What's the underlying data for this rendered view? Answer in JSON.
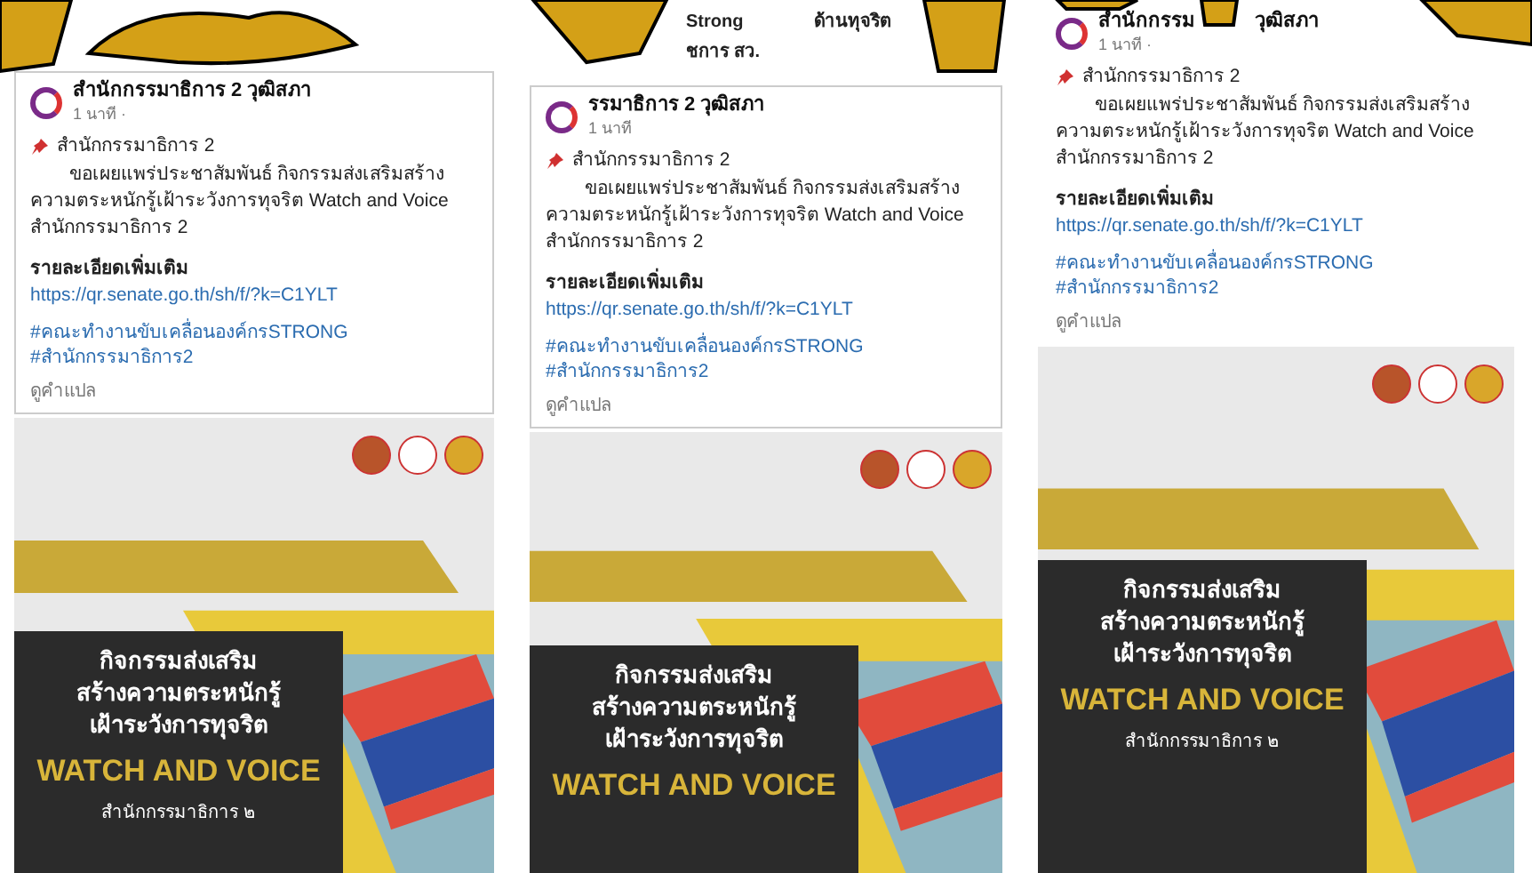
{
  "panels": [
    {
      "post": {
        "author": "สำนักกรรมาธิการ 2 วุฒิสภา",
        "time": "1 นาที ·",
        "org": "สำนักกรรมาธิการ 2",
        "body": "ขอเผยแพร่ประชาสัมพันธ์ กิจกรรมส่งเสริมสร้างความตระหนักรู้เฝ้าระวังการทุจริต Watch and Voice สำนักกรรมาธิการ 2",
        "more_label": "รายละเอียดเพิ่มเติม",
        "link": "https://qr.senate.go.th/sh/f/?k=C1YLT",
        "hashtags": [
          "#คณะทำงานขับเคลื่อนองค์กรSTRONG",
          "#สำนักกรรมาธิการ2"
        ],
        "translate": "ดูคำแปล"
      },
      "poster": {
        "title_lines": [
          "กิจกรรมส่งเสริม",
          "สร้างความตระหนักรู้",
          "เฝ้าระวังการทุจริต"
        ],
        "headline": "WATCH AND VOICE",
        "footer": "สำนักกรรมาธิการ ๒"
      }
    },
    {
      "header_fragments": [
        "Strong",
        "ด้านทุจริต",
        "ชการ สว."
      ],
      "post": {
        "author": "รรมาธิการ 2 วุฒิสภา",
        "time": "1 นาที",
        "org": "สำนักกรรมาธิการ 2",
        "body": "ขอเผยแพร่ประชาสัมพันธ์ กิจกรรมส่งเสริมสร้างความตระหนักรู้เฝ้าระวังการทุจริต Watch and Voice สำนักกรรมาธิการ 2",
        "more_label": "รายละเอียดเพิ่มเติม",
        "link": "https://qr.senate.go.th/sh/f/?k=C1YLT",
        "hashtags": [
          "#คณะทำงานขับเคลื่อนองค์กรSTRONG",
          "#สำนักกรรมาธิการ2"
        ],
        "translate": "ดูคำแปล"
      },
      "poster": {
        "title_lines": [
          "กิจกรรมส่งเสริม",
          "สร้างความตระหนักรู้",
          "เฝ้าระวังการทุจริต"
        ],
        "headline": "WATCH AND VOICE"
      }
    },
    {
      "post": {
        "author": "สำนักกรรม",
        "author_tail": "วุฒิสภา",
        "time": "1 นาที ·",
        "org": "สำนักกรรมาธิการ 2",
        "body": "ขอเผยแพร่ประชาสัมพันธ์ กิจกรรมส่งเสริมสร้างความตระหนักรู้เฝ้าระวังการทุจริต Watch and Voice สำนักกรรมาธิการ 2",
        "more_label": "รายละเอียดเพิ่มเติม",
        "link": "https://qr.senate.go.th/sh/f/?k=C1YLT",
        "hashtags": [
          "#คณะทำงานขับเคลื่อนองค์กรSTRONG",
          "#สำนักกรรมาธิการ2"
        ],
        "translate": "ดูคำแปล"
      },
      "poster": {
        "title_lines": [
          "กิจกรรมส่งเสริม",
          "สร้างความตระหนักรู้",
          "เฝ้าระวังการทุจริต"
        ],
        "headline": "WATCH AND VOICE",
        "footer": "สำนักกรรมาธิการ ๒"
      }
    }
  ]
}
